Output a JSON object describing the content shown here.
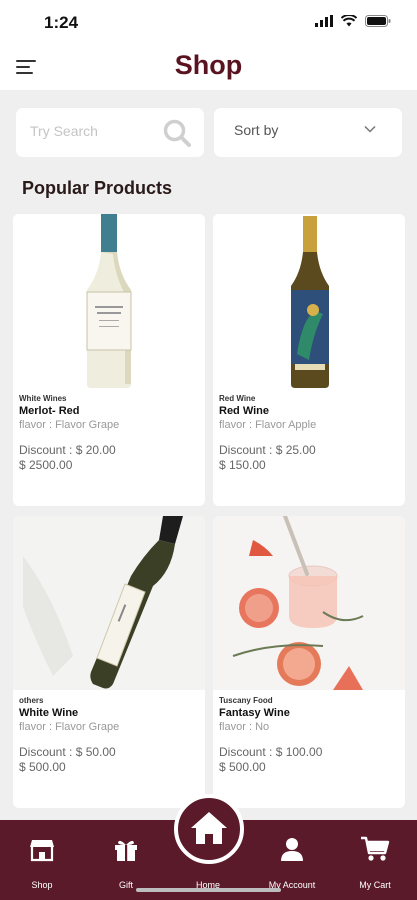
{
  "status": {
    "time": "1:24"
  },
  "header": {
    "title": "Shop"
  },
  "search": {
    "placeholder": "Try Search"
  },
  "sort": {
    "label": "Sort by"
  },
  "section": {
    "title": "Popular Products"
  },
  "products": [
    {
      "category": "White Wines",
      "name": "Merlot- Red",
      "flavor": "flavor : Flavor Grape",
      "discount": "Discount : $ 20.00",
      "price": "$ 2500.00"
    },
    {
      "category": "Red Wine",
      "name": "Red Wine",
      "flavor": "flavor : Flavor Apple",
      "discount": "Discount : $ 25.00",
      "price": "$ 150.00"
    },
    {
      "category": "others",
      "name": "White Wine",
      "flavor": "flavor : Flavor Grape",
      "discount": "Discount : $ 50.00",
      "price": "$ 500.00"
    },
    {
      "category": "Tuscany Food",
      "name": "Fantasy Wine",
      "flavor": "flavor : No",
      "discount": "Discount : $ 100.00",
      "price": "$ 500.00"
    }
  ],
  "nav": {
    "shop": "Shop",
    "gift": "Gift",
    "home": "Home",
    "account": "My Account",
    "cart": "My Cart"
  },
  "colors": {
    "brand": "#5b1a2a",
    "title": "#5a1320",
    "background": "#efefef"
  },
  "icons": [
    "menu-icon",
    "search-icon",
    "chevron-down-icon",
    "shop-icon",
    "gift-icon",
    "home-icon",
    "account-icon",
    "cart-icon"
  ]
}
